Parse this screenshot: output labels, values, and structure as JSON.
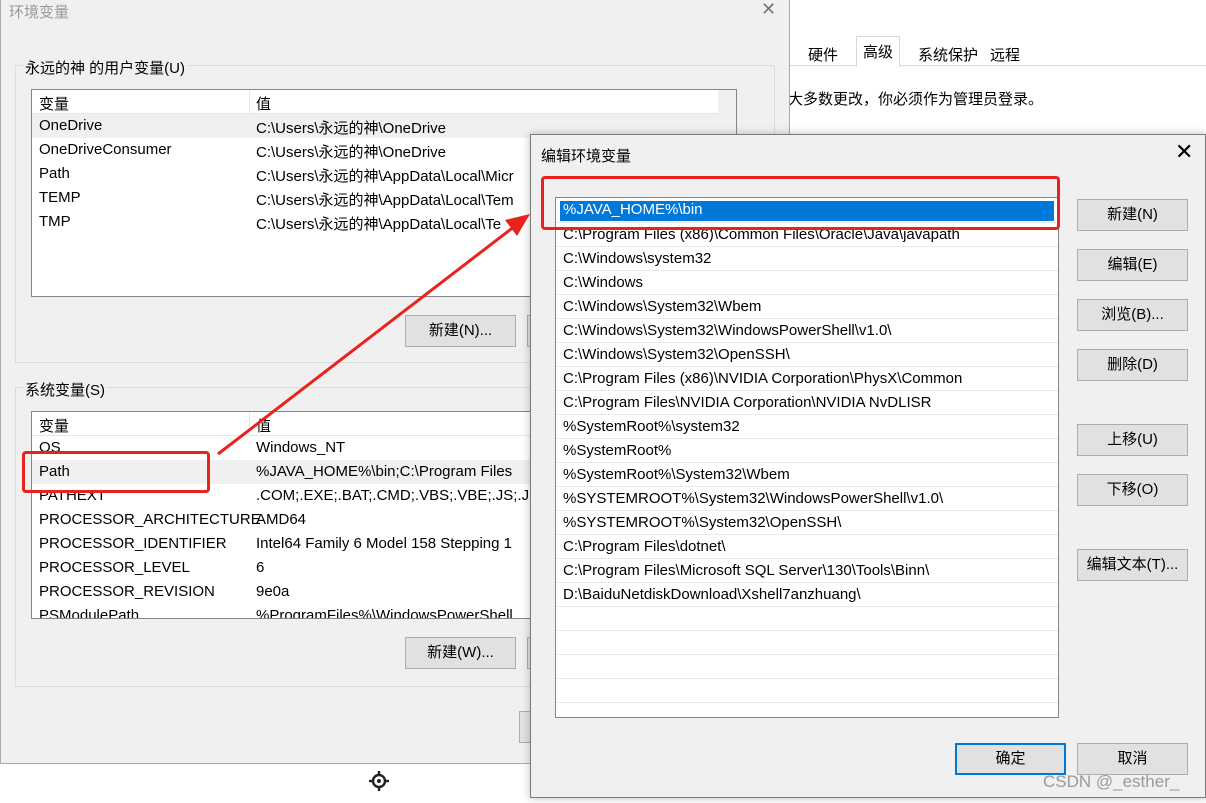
{
  "sysprops": {
    "tabs": [
      "硬件",
      "高级",
      "系统保护",
      "远程"
    ],
    "active_tab": "高级",
    "notice": "大多数更改，你必须作为管理员登录。"
  },
  "env_window": {
    "title": "环境变量",
    "user_group_label": "永远的神 的用户变量(U)",
    "columns": [
      "变量",
      "值"
    ],
    "user_vars": [
      {
        "name": "OneDrive",
        "value": "C:\\Users\\永远的神\\OneDrive"
      },
      {
        "name": "OneDriveConsumer",
        "value": "C:\\Users\\永远的神\\OneDrive"
      },
      {
        "name": "Path",
        "value": "C:\\Users\\永远的神\\AppData\\Local\\Micr"
      },
      {
        "name": "TEMP",
        "value": "C:\\Users\\永远的神\\AppData\\Local\\Tem"
      },
      {
        "name": "TMP",
        "value": "C:\\Users\\永远的神\\AppData\\Local\\Te"
      }
    ],
    "user_new_button": "新建(N)...",
    "system_group_label": "系统变量(S)",
    "system_vars": [
      {
        "name": "OS",
        "value": "Windows_NT"
      },
      {
        "name": "Path",
        "value": "%JAVA_HOME%\\bin;C:\\Program Files"
      },
      {
        "name": "PATHEXT",
        "value": ".COM;.EXE;.BAT;.CMD;.VBS;.VBE;.JS;.JSE"
      },
      {
        "name": "PROCESSOR_ARCHITECTURE",
        "value": "AMD64"
      },
      {
        "name": "PROCESSOR_IDENTIFIER",
        "value": "Intel64 Family 6 Model 158 Stepping 1"
      },
      {
        "name": "PROCESSOR_LEVEL",
        "value": "6"
      },
      {
        "name": "PROCESSOR_REVISION",
        "value": "9e0a"
      },
      {
        "name": "PSModulePath",
        "value": "%ProgramFiles%\\WindowsPowerShell"
      }
    ],
    "system_new_button": "新建(W)..."
  },
  "edit_dialog": {
    "title": "编辑环境变量",
    "paths": [
      "%JAVA_HOME%\\bin",
      "C:\\Program Files (x86)\\Common Files\\Oracle\\Java\\javapath",
      "C:\\Windows\\system32",
      "C:\\Windows",
      "C:\\Windows\\System32\\Wbem",
      "C:\\Windows\\System32\\WindowsPowerShell\\v1.0\\",
      "C:\\Windows\\System32\\OpenSSH\\",
      "C:\\Program Files (x86)\\NVIDIA Corporation\\PhysX\\Common",
      "C:\\Program Files\\NVIDIA Corporation\\NVIDIA NvDLISR",
      "%SystemRoot%\\system32",
      "%SystemRoot%",
      "%SystemRoot%\\System32\\Wbem",
      "%SYSTEMROOT%\\System32\\WindowsPowerShell\\v1.0\\",
      "%SYSTEMROOT%\\System32\\OpenSSH\\",
      "C:\\Program Files\\dotnet\\",
      "C:\\Program Files\\Microsoft SQL Server\\130\\Tools\\Binn\\",
      "D:\\BaiduNetdiskDownload\\Xshell7anzhuang\\"
    ],
    "buttons": {
      "new": "新建(N)",
      "edit": "编辑(E)",
      "browse": "浏览(B)...",
      "delete": "删除(D)",
      "move_up": "上移(U)",
      "move_down": "下移(O)",
      "edit_text": "编辑文本(T)...",
      "ok": "确定",
      "cancel": "取消"
    }
  },
  "watermark": "CSDN @_esther_",
  "colors": {
    "annotation_red": "#e8221c",
    "selection_blue": "#0078d7"
  }
}
